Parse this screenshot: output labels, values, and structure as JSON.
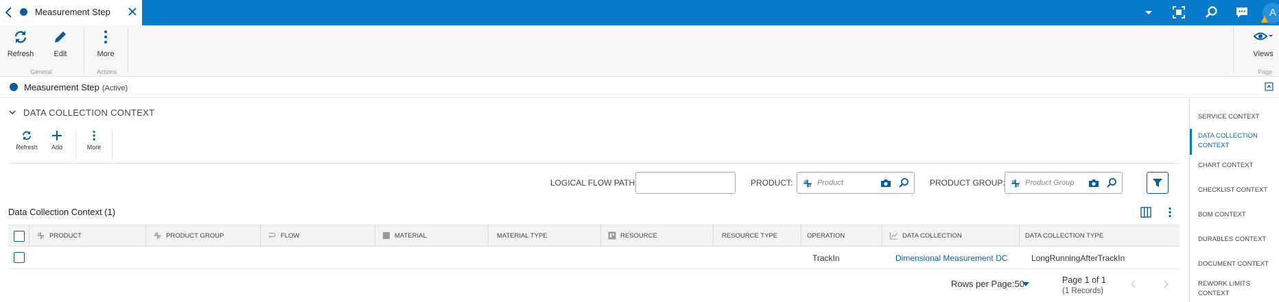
{
  "tab": {
    "title": "Measurement Step"
  },
  "user": {
    "initial": "A"
  },
  "ribbon": {
    "refresh_label": "Refresh",
    "edit_label": "Edit",
    "more_label": "More",
    "views_label": "Views",
    "group_general": "General",
    "group_actions": "Actions",
    "group_page": "Page"
  },
  "entity": {
    "name": "Measurement Step",
    "state": "(Active)"
  },
  "section": {
    "title": "DATA COLLECTION CONTEXT",
    "refresh_label": "Refresh",
    "add_label": "Add",
    "more_label": "More"
  },
  "filters": {
    "logical_flow_path_label": "LOGICAL FLOW PATH:",
    "logical_flow_path_value": "",
    "product_label": "PRODUCT:",
    "product_placeholder": "Product",
    "product_group_label": "PRODUCT GROUP:",
    "product_group_placeholder": "Product Group"
  },
  "grid": {
    "title": "Data Collection Context (1)",
    "columns": [
      "PRODUCT",
      "PRODUCT GROUP",
      "FLOW",
      "MATERIAL",
      "MATERIAL TYPE",
      "RESOURCE",
      "RESOURCE TYPE",
      "OPERATION",
      "DATA COLLECTION",
      "DATA COLLECTION TYPE"
    ],
    "rows": [
      {
        "product": "",
        "product_group": "",
        "flow": "",
        "material": "",
        "material_type": "",
        "resource": "",
        "resource_type": "",
        "operation": "TrackIn",
        "data_collection": "Dimensional Measurement DC",
        "data_collection_type": "LongRunningAfterTrackIn"
      }
    ]
  },
  "pager": {
    "rows_per_page": "Rows per Page:50",
    "page": "Page 1 of 1",
    "records": "(1 Records)"
  },
  "right_nav": {
    "items": [
      "SERVICE CONTEXT",
      "DATA COLLECTION CONTEXT",
      "CHART CONTEXT",
      "CHECKLIST CONTEXT",
      "BOM CONTEXT",
      "DURABLES CONTEXT",
      "DOCUMENT CONTEXT",
      "REWORK LIMITS CONTEXT"
    ],
    "active": "DATA COLLECTION CONTEXT"
  },
  "colors": {
    "brand_blue": "#0a7acc",
    "dark_blue": "#0a5d9c",
    "link_blue": "#0a66b0"
  }
}
